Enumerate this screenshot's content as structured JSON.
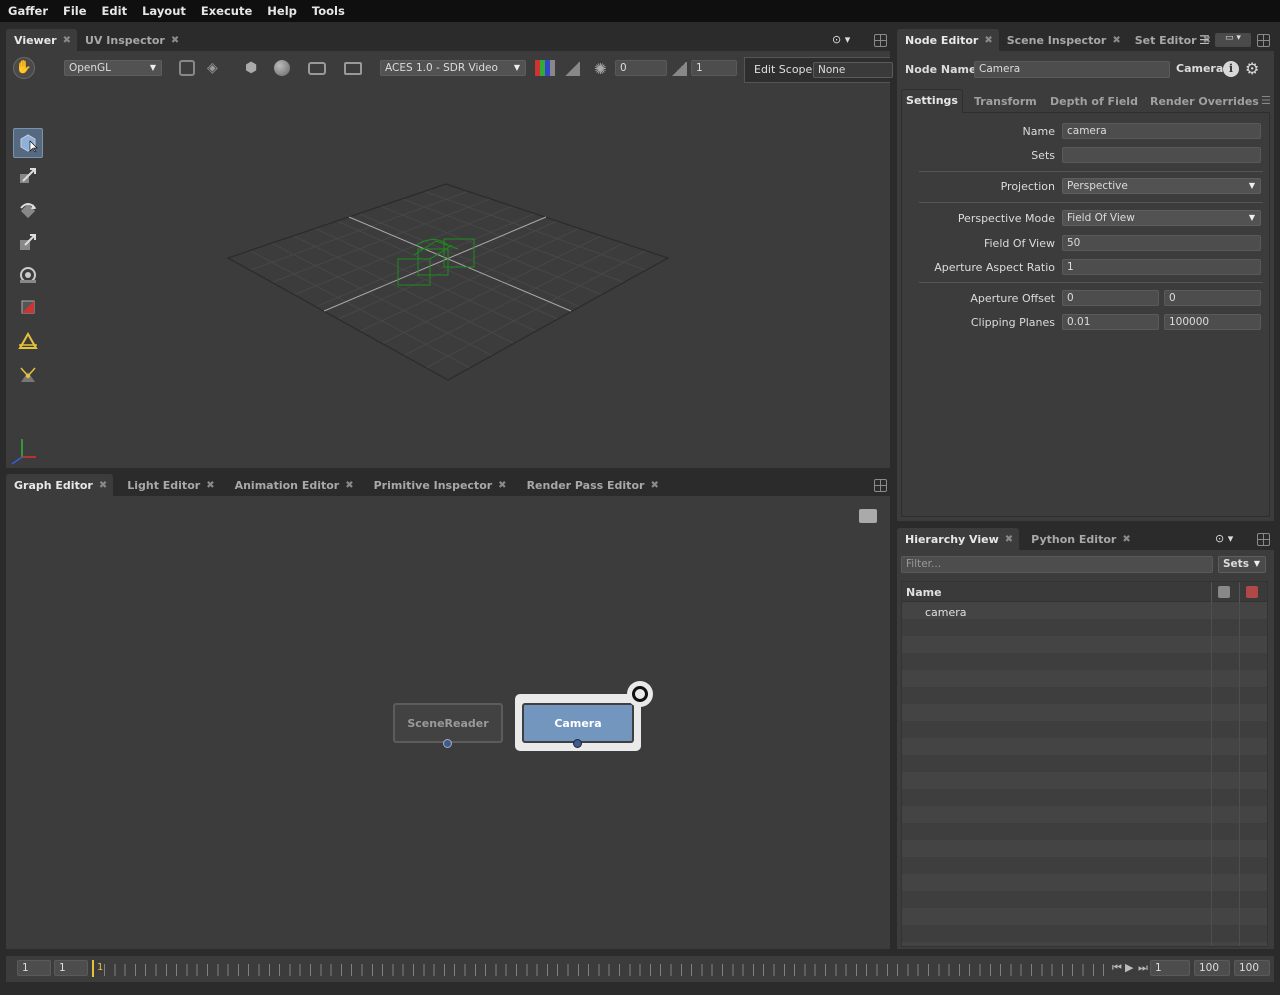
{
  "menu": [
    "Gaffer",
    "File",
    "Edit",
    "Layout",
    "Execute",
    "Help",
    "Tools"
  ],
  "viewer": {
    "tabs": [
      {
        "label": "Viewer",
        "active": true
      },
      {
        "label": "UV Inspector",
        "active": false
      }
    ],
    "renderer": "OpenGL",
    "display_transform": "ACES 1.0 - SDR Video",
    "exposure": "0",
    "gamma": "1",
    "edit_scope_label": "Edit Scope",
    "edit_scope_value": "None"
  },
  "graph_editor": {
    "tabs": [
      {
        "label": "Graph Editor",
        "active": true
      },
      {
        "label": "Light Editor",
        "active": false
      },
      {
        "label": "Animation Editor",
        "active": false
      },
      {
        "label": "Primitive Inspector",
        "active": false
      },
      {
        "label": "Render Pass Editor",
        "active": false
      }
    ],
    "nodes": [
      {
        "label": "SceneReader"
      },
      {
        "label": "Camera"
      }
    ]
  },
  "node_editor": {
    "tabs": [
      {
        "label": "Node Editor",
        "active": true
      },
      {
        "label": "Scene Inspector",
        "active": false
      },
      {
        "label": "Set Editor",
        "active": false
      }
    ],
    "node_name_label": "Node Name",
    "node_name_value": "Camera",
    "node_type": "Camera",
    "section_tabs": [
      "Settings",
      "Transform",
      "Depth of Field",
      "Render Overrides"
    ],
    "fields": {
      "name_label": "Name",
      "name_value": "camera",
      "sets_label": "Sets",
      "sets_value": "",
      "projection_label": "Projection",
      "projection_value": "Perspective",
      "perspective_mode_label": "Perspective Mode",
      "perspective_mode_value": "Field Of View",
      "fov_label": "Field Of View",
      "fov_value": "50",
      "aspect_label": "Aperture Aspect Ratio",
      "aspect_value": "1",
      "offset_label": "Aperture Offset",
      "offset_x": "0",
      "offset_y": "0",
      "clip_label": "Clipping Planes",
      "clip_near": "0.01",
      "clip_far": "100000"
    }
  },
  "hierarchy": {
    "tabs": [
      {
        "label": "Hierarchy View",
        "active": true
      },
      {
        "label": "Python Editor",
        "active": false
      }
    ],
    "filter_placeholder": "Filter...",
    "sets_button": "Sets",
    "column_name": "Name",
    "items": [
      "camera"
    ]
  },
  "timeline": {
    "start": "1",
    "current_start": "1",
    "playhead": "1",
    "current_frame": "1",
    "end": "100",
    "range_end": "100"
  },
  "colors": {
    "accent": "#7396bf",
    "selected_node": "#7396bf",
    "grid": "#4a4a4a",
    "camera_wire": "#1e8c1e"
  }
}
